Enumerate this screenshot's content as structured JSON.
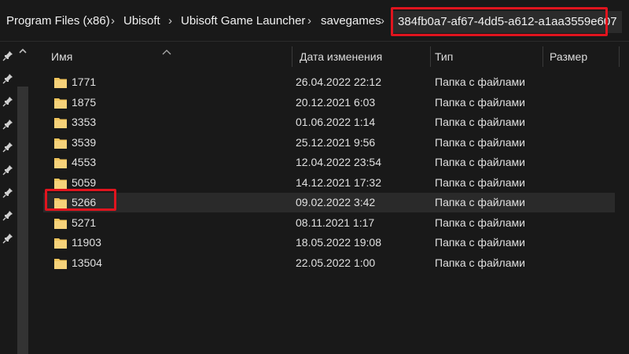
{
  "breadcrumb": {
    "items": [
      "Program Files (x86)",
      "Ubisoft",
      "Ubisoft Game Launcher",
      "savegames",
      "384fb0a7-af67-4dd5-a612-a1aa3559e607"
    ],
    "separator": "›"
  },
  "columns": {
    "name": "Имя",
    "date": "Дата изменения",
    "type": "Тип",
    "size": "Размер"
  },
  "rows": [
    {
      "name": "1771",
      "date": "26.04.2022 22:12",
      "type": "Папка с файлами"
    },
    {
      "name": "1875",
      "date": "20.12.2021 6:03",
      "type": "Папка с файлами"
    },
    {
      "name": "3353",
      "date": "01.06.2022 1:14",
      "type": "Папка с файлами"
    },
    {
      "name": "3539",
      "date": "25.12.2021 9:56",
      "type": "Папка с файлами"
    },
    {
      "name": "4553",
      "date": "12.04.2022 23:54",
      "type": "Папка с файлами"
    },
    {
      "name": "5059",
      "date": "14.12.2021 17:32",
      "type": "Папка с файлами"
    },
    {
      "name": "5266",
      "date": "09.02.2022 3:42",
      "type": "Папка с файлами"
    },
    {
      "name": "5271",
      "date": "08.11.2021 1:17",
      "type": "Папка с файлами"
    },
    {
      "name": "11903",
      "date": "18.05.2022 19:08",
      "type": "Папка с файлами"
    },
    {
      "name": "13504",
      "date": "22.05.2022 1:00",
      "type": "Папка с файлами"
    }
  ],
  "colors": {
    "background": "#191919",
    "highlight": "#e0141e",
    "folder": "#f2c55c",
    "selected_row": "#2a2a2a"
  },
  "icons": {
    "pin": "pin-icon",
    "folder": "folder-icon",
    "sort": "sort-ascending-icon",
    "chevron": "chevron-up-icon"
  }
}
